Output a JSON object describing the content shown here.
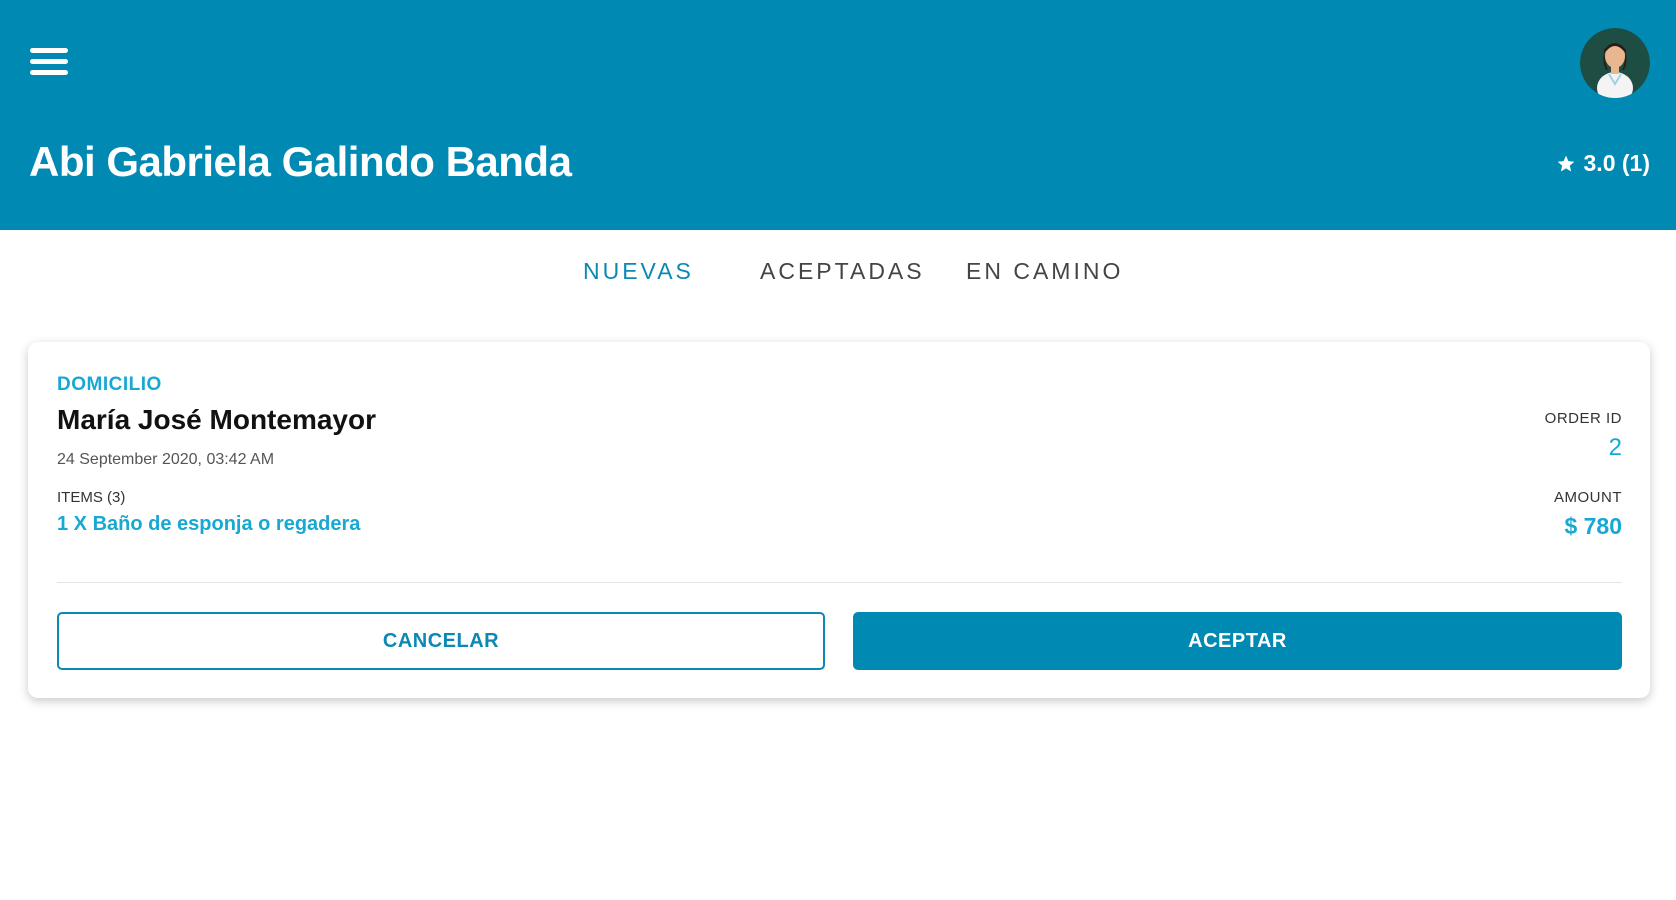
{
  "header": {
    "title": "Abi Gabriela Galindo Banda",
    "rating": "3.0 (1)",
    "menu_icon": "menu-icon",
    "avatar_icon": "doctor-avatar",
    "background_color": "#008ab3"
  },
  "tabs": [
    {
      "label": "NUEVAS",
      "active": true
    },
    {
      "label": "ACEPTADAS",
      "active": false
    },
    {
      "label": "EN CAMINO",
      "active": false
    }
  ],
  "order": {
    "type": "DOMICILIO",
    "customer": "María José Montemayor",
    "date": "24 September 2020, 03:42 AM",
    "items_label": "ITEMS (3)",
    "item_line": "1 X Baño de esponja o regadera",
    "order_id_label": "ORDER ID",
    "order_id": "2",
    "amount_label": "AMOUNT",
    "amount": "$ 780"
  },
  "actions": {
    "cancel_label": "CANCELAR",
    "accept_label": "ACEPTAR"
  },
  "colors": {
    "primary": "#008ab3",
    "accent_text": "#17a8d3"
  }
}
